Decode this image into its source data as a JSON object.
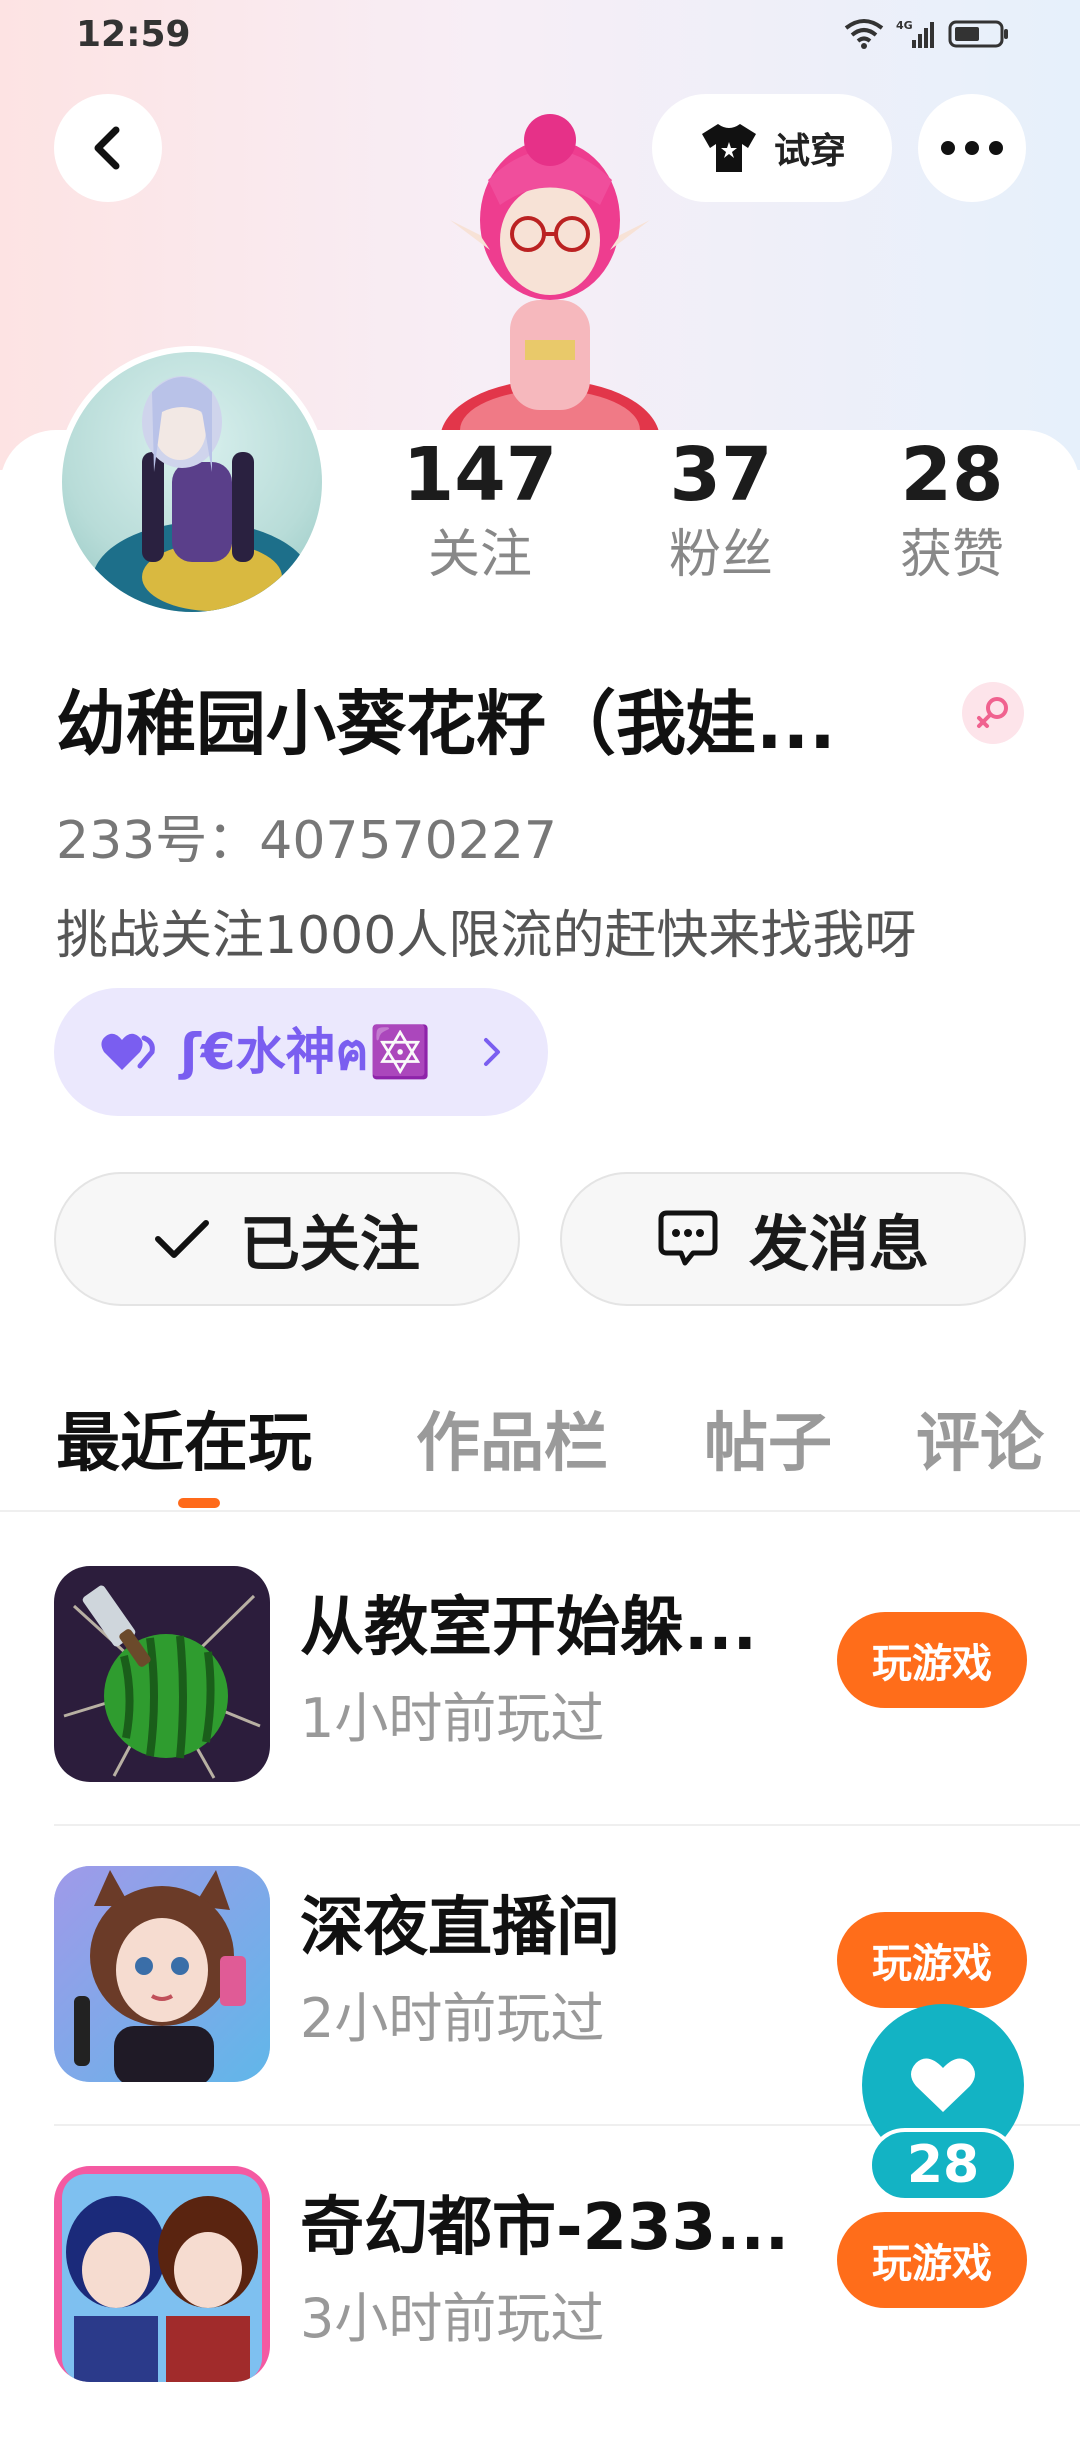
{
  "status_bar": {
    "time": "12:59",
    "network": "4G"
  },
  "header": {
    "try_on_label": "试穿"
  },
  "profile": {
    "stats": [
      {
        "value": "147",
        "label": "关注"
      },
      {
        "value": "37",
        "label": "粉丝"
      },
      {
        "value": "28",
        "label": "获赞"
      }
    ],
    "name": "幼稚园小葵花籽（我娃...",
    "uid": "233号：407570227",
    "bio": "挑战关注1000人限流的赶快来找我呀",
    "tag_label": "ʃ€水神ฅ🔯"
  },
  "actions": {
    "follow_label": "已关注",
    "message_label": "发消息"
  },
  "tabs": [
    {
      "label": "最近在玩",
      "active": true
    },
    {
      "label": "作品栏"
    },
    {
      "label": "帖子"
    },
    {
      "label": "评论"
    }
  ],
  "games": [
    {
      "title": "从教室开始躲...",
      "sub": "1小时前玩过",
      "play_label": "玩游戏"
    },
    {
      "title": "深夜直播间",
      "sub": "2小时前玩过",
      "play_label": "玩游戏"
    },
    {
      "title": "奇幻都市-233...",
      "sub": "3小时前玩过",
      "play_label": "玩游戏"
    }
  ],
  "like_fab": {
    "count": "28"
  },
  "colors": {
    "accent": "#ff6d1a",
    "teal": "#13b3c4",
    "tag_purple": "#7a5ef0"
  }
}
